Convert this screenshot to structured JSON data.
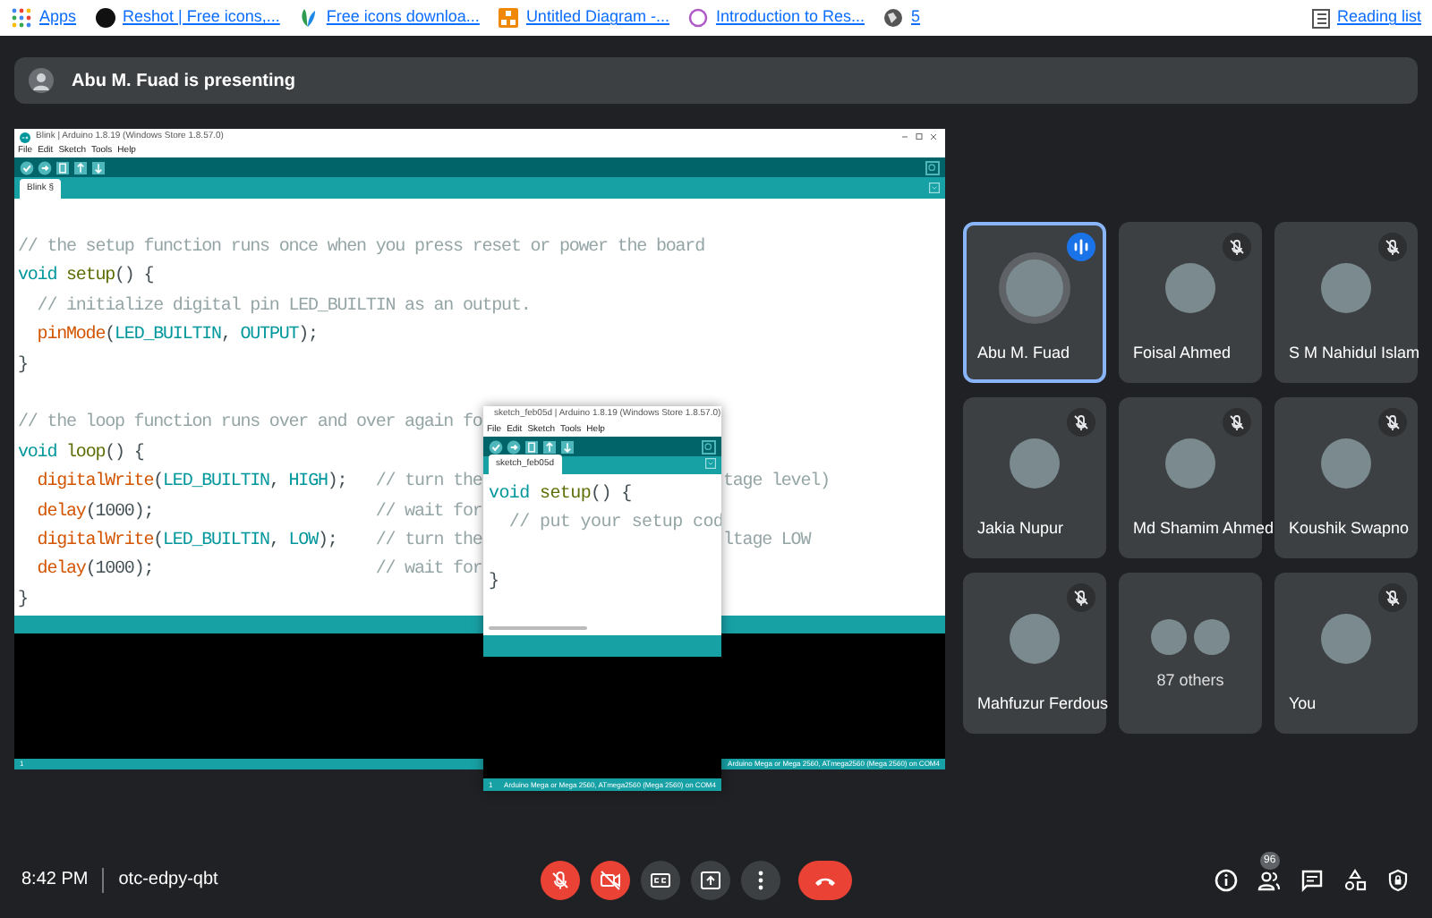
{
  "browser": {
    "bookmarks": [
      {
        "kind": "apps",
        "label": "Apps"
      },
      {
        "kind": "dark-circle",
        "label": "Reshot | Free icons,..."
      },
      {
        "kind": "leaf",
        "label": "Free icons downloa..."
      },
      {
        "kind": "orange-square",
        "label": "Untitled Diagram -..."
      },
      {
        "kind": "ring",
        "label": "Introduction to Res..."
      },
      {
        "kind": "globe",
        "label": "5"
      }
    ],
    "reading_list": "Reading list"
  },
  "presenting_bar": {
    "text": "Abu M. Fuad is presenting"
  },
  "shared_screen": {
    "main_window": {
      "title": "Blink | Arduino 1.8.19 (Windows Store 1.8.57.0)",
      "menu": [
        "File",
        "Edit",
        "Sketch",
        "Tools",
        "Help"
      ],
      "tab": "Blink §",
      "code": [
        {
          "segments": [
            {
              "kind": "comment",
              "text": "// the setup function runs once when you press reset or power the board"
            }
          ]
        },
        {
          "segments": [
            {
              "kind": "keyword",
              "text": "void "
            },
            {
              "kind": "name",
              "text": "setup"
            },
            {
              "kind": "plain",
              "text": "() {"
            }
          ]
        },
        {
          "segments": [
            {
              "kind": "comment",
              "text": "  // initialize digital pin LED_BUILTIN as an output."
            }
          ]
        },
        {
          "segments": [
            {
              "kind": "call",
              "text": "  pinMode"
            },
            {
              "kind": "plain",
              "text": "("
            },
            {
              "kind": "constant",
              "text": "LED_BUILTIN"
            },
            {
              "kind": "plain",
              "text": ", "
            },
            {
              "kind": "constant",
              "text": "OUTPUT"
            },
            {
              "kind": "plain",
              "text": ");"
            }
          ]
        },
        {
          "segments": [
            {
              "kind": "plain",
              "text": "}"
            }
          ]
        },
        {
          "gap_before": true,
          "segments": [
            {
              "kind": "comment",
              "text": "// the loop function runs over and over again fo"
            }
          ]
        },
        {
          "segments": [
            {
              "kind": "keyword",
              "text": "void "
            },
            {
              "kind": "name",
              "text": "loop"
            },
            {
              "kind": "plain",
              "text": "() {"
            }
          ]
        },
        {
          "segments": [
            {
              "kind": "call",
              "text": "  digitalWrite"
            },
            {
              "kind": "plain",
              "text": "("
            },
            {
              "kind": "constant",
              "text": "LED_BUILTIN"
            },
            {
              "kind": "plain",
              "text": ", "
            },
            {
              "kind": "constant",
              "text": "HIGH"
            },
            {
              "kind": "plain",
              "text": ");   "
            },
            {
              "kind": "comment",
              "text": "// turn the"
            }
          ],
          "tail": "tage level)"
        },
        {
          "segments": [
            {
              "kind": "call",
              "text": "  delay"
            },
            {
              "kind": "plain",
              "text": "(1000);                       "
            },
            {
              "kind": "comment",
              "text": "// wait for"
            }
          ]
        },
        {
          "segments": [
            {
              "kind": "call",
              "text": "  digitalWrite"
            },
            {
              "kind": "plain",
              "text": "("
            },
            {
              "kind": "constant",
              "text": "LED_BUILTIN"
            },
            {
              "kind": "plain",
              "text": ", "
            },
            {
              "kind": "constant",
              "text": "LOW"
            },
            {
              "kind": "plain",
              "text": ");    "
            },
            {
              "kind": "comment",
              "text": "// turn the"
            }
          ],
          "tail": "ltage LOW"
        },
        {
          "segments": [
            {
              "kind": "call",
              "text": "  delay"
            },
            {
              "kind": "plain",
              "text": "(1000);                       "
            },
            {
              "kind": "comment",
              "text": "// wait for"
            }
          ]
        },
        {
          "segments": [
            {
              "kind": "plain",
              "text": "}"
            }
          ]
        }
      ],
      "status_line": "1",
      "status_board": "Arduino Mega or Mega 2560, ATmega2560 (Mega 2560) on COM4"
    },
    "popup_window": {
      "title": "sketch_feb05d | Arduino 1.8.19 (Windows Store 1.8.57.0)",
      "menu": [
        "File",
        "Edit",
        "Sketch",
        "Tools",
        "Help"
      ],
      "tab": "sketch_feb05d",
      "code": [
        {
          "segments": [
            {
              "kind": "keyword",
              "text": "void "
            },
            {
              "kind": "name",
              "text": "setup"
            },
            {
              "kind": "plain",
              "text": "() {"
            }
          ]
        },
        {
          "segments": [
            {
              "kind": "comment",
              "text": "  // put your setup cod"
            }
          ]
        },
        {
          "gap_before": true,
          "segments": [
            {
              "kind": "plain",
              "text": "}"
            }
          ]
        }
      ],
      "status_line": "1",
      "status_board": "Arduino Mega or Mega 2560, ATmega2560 (Mega 2560) on COM4"
    }
  },
  "participants": [
    {
      "kind": "person",
      "name": "Abu M. Fuad",
      "muted": false,
      "speaking": true,
      "selected": true
    },
    {
      "kind": "person",
      "name": "Foisal Ahmed",
      "muted": true,
      "speaking": false,
      "selected": false
    },
    {
      "kind": "person",
      "name": "S M Nahidul Islam",
      "muted": true,
      "speaking": false,
      "selected": false
    },
    {
      "kind": "person",
      "name": "Jakia Nupur",
      "muted": true,
      "speaking": false,
      "selected": false
    },
    {
      "kind": "person",
      "name": "Md Shamim Ahmed",
      "muted": true,
      "speaking": false,
      "selected": false
    },
    {
      "kind": "person",
      "name": "Koushik Swapno",
      "muted": true,
      "speaking": false,
      "selected": false
    },
    {
      "kind": "person",
      "name": "Mahfuzur Ferdous",
      "muted": true,
      "speaking": false,
      "selected": false
    },
    {
      "kind": "others",
      "name": "87 others",
      "selected": false
    },
    {
      "kind": "person",
      "name": "You",
      "muted": true,
      "speaking": false,
      "selected": false
    }
  ],
  "meeting_bar": {
    "time": "8:42 PM",
    "meeting_code": "otc-edpy-qbt",
    "controls": [
      {
        "kind": "mic",
        "off": true
      },
      {
        "kind": "camera",
        "off": true
      },
      {
        "kind": "captions",
        "off": false
      },
      {
        "kind": "present",
        "off": false
      },
      {
        "kind": "more",
        "off": false
      },
      {
        "kind": "hangup"
      }
    ],
    "side_buttons": [
      {
        "kind": "info"
      },
      {
        "kind": "people",
        "badge": "96"
      },
      {
        "kind": "chat"
      },
      {
        "kind": "activities"
      },
      {
        "kind": "host-controls"
      }
    ]
  }
}
